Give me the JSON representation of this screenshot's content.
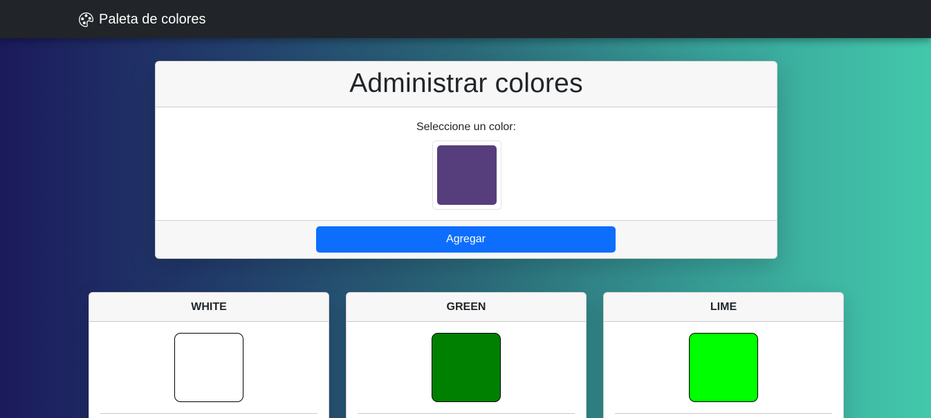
{
  "navbar": {
    "brand_icon": "palette-icon",
    "brand_text": "Paleta de colores"
  },
  "form": {
    "title": "Administrar colores",
    "color_label": "Seleccione un color:",
    "selected_color": "#563d7c",
    "submit_label": "Agregar"
  },
  "colors": [
    {
      "name": "WHITE",
      "hex": "#ffffff"
    },
    {
      "name": "GREEN",
      "hex": "#008000"
    },
    {
      "name": "LIME",
      "hex": "#00ff00"
    }
  ],
  "theme": {
    "navbar_bg": "#212529",
    "primary": "#0d6efd"
  }
}
